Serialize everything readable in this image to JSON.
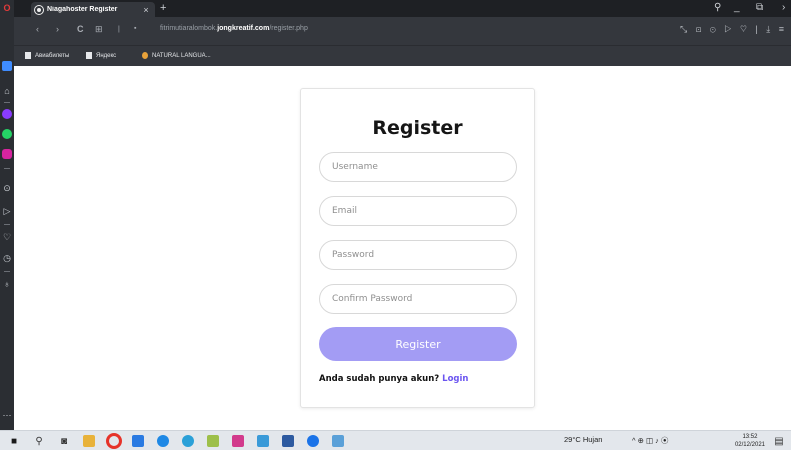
{
  "browser": {
    "tab": {
      "title": "Niagahoster Register",
      "close_glyph": "×",
      "new_tab_glyph": "+"
    },
    "url": {
      "host_prefix": "fitrimutiaralombok.",
      "host_domain": "jongkreatif.com",
      "path": "/register.php"
    },
    "nav": {
      "back": "‹",
      "forward": "›",
      "reload": "C",
      "grid": "⊞",
      "lock": "🔒"
    },
    "window": {
      "search": "⚲",
      "minimize": "_",
      "snap": "⧉",
      "more": "›"
    },
    "toolbar_icons": "⤡ ⊡ ⊙ ▷ ♡ | ⤓ ≡",
    "bookmarks": [
      {
        "label": "Авиабилеты",
        "icon": "file-icon"
      },
      {
        "label": "Яндекс",
        "icon": "file-icon"
      },
      {
        "label": "NATURAL LANGUA...",
        "icon": "orange-circle-icon"
      }
    ]
  },
  "page": {
    "title": "Register",
    "username_placeholder": "Username",
    "email_placeholder": "Email",
    "password_placeholder": "Password",
    "confirm_placeholder": "Confirm Password",
    "submit_label": "Register",
    "login_prompt": "Anda sudah punya akun?",
    "login_link": "Login"
  },
  "taskbar": {
    "weather": "29°C  Hujan",
    "tray_icons": "^  ⊕  ◫  ♪ ⦿",
    "time": "13:52",
    "date": "02/12/2021"
  },
  "colors": {
    "accent": "#a39cf4",
    "link": "#6b55f0",
    "chrome_dark": "#34373d"
  }
}
